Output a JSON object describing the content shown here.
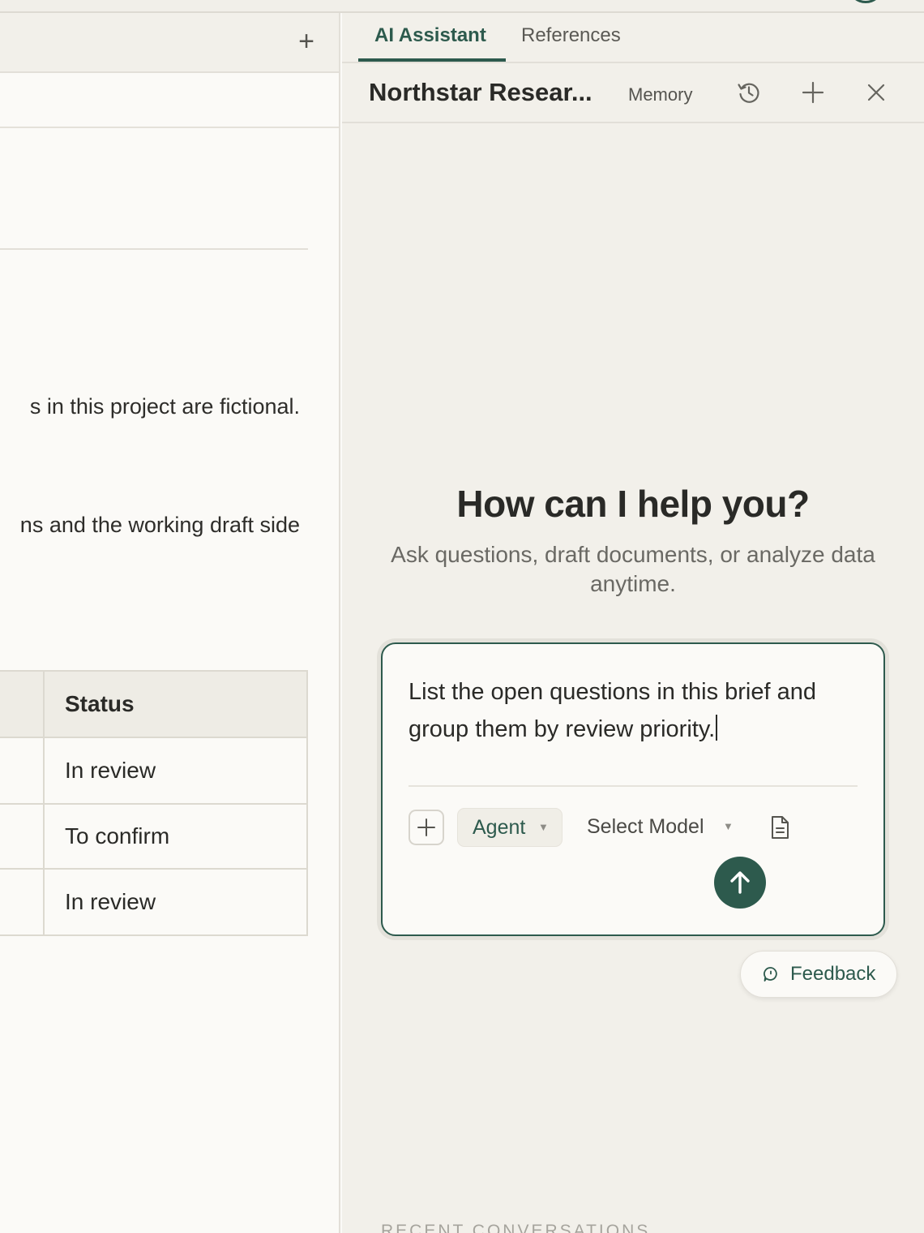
{
  "document": {
    "add_tab_glyph": "+",
    "text_line_1": "s in this project are fictional.",
    "text_line_2": "ns and the working draft side",
    "table": {
      "header": "Status",
      "rows": [
        "In review",
        "To confirm",
        "In review"
      ]
    }
  },
  "assistant": {
    "tabs": [
      "AI Assistant",
      "References"
    ],
    "active_tab": "AI Assistant",
    "header": {
      "title": "Northstar Resear...",
      "memory_label": "Memory"
    },
    "hero": {
      "title": "How can I help you?",
      "subtitle": "Ask questions, draft documents, or analyze data anytime."
    },
    "composer": {
      "input_value": "List the open questions in this brief and group them by review priority.",
      "mode_label": "Agent",
      "model_label": "Select Model"
    },
    "feedback_label": "Feedback",
    "recent_heading": "RECENT CONVERSATIONS"
  },
  "colors": {
    "accent": "#2d5a4d",
    "pane_bg": "#f2f0ea",
    "doc_bg": "#fbfaf7"
  }
}
